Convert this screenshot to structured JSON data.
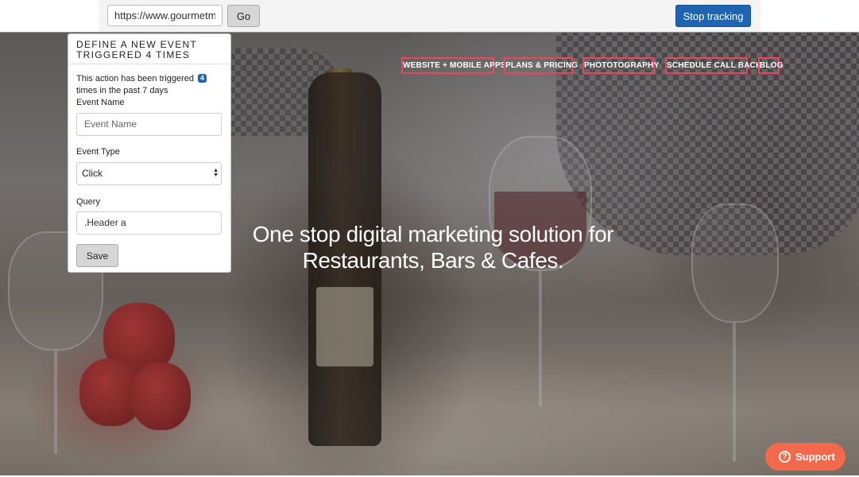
{
  "toolbar": {
    "url_value": "https://www.gourmetma",
    "go_label": "Go",
    "stop_label": "Stop tracking"
  },
  "site": {
    "nav": [
      "WEBSITE + MOBILE APPS",
      "PLANS & PRICING",
      "PHOTOTOGRAPHY",
      "SCHEDULE CALL BACK",
      "BLOG"
    ],
    "hero_line1": "One stop digital marketing solution for",
    "hero_line2": "Restaurants, Bars & Cafes.",
    "support_label": "Support",
    "support_icon": "question-circle-icon",
    "nav_highlight_color": "#e8475f"
  },
  "panel": {
    "title": "DEFINE A NEW EVENT TRIGGERED 4 TIMES",
    "info_prefix": "This action has been triggered",
    "trigger_count": "4",
    "info_suffix": "times in the past 7 days",
    "event_name_label": "Event Name",
    "event_name_placeholder": "Event Name",
    "event_type_label": "Event Type",
    "event_type_value": "Click",
    "query_label": "Query",
    "query_value": ".Header a",
    "save_label": "Save"
  },
  "colors": {
    "stop_button": "#1f63b3",
    "badge": "#1f63b3",
    "support_button": "#f26a4b"
  }
}
